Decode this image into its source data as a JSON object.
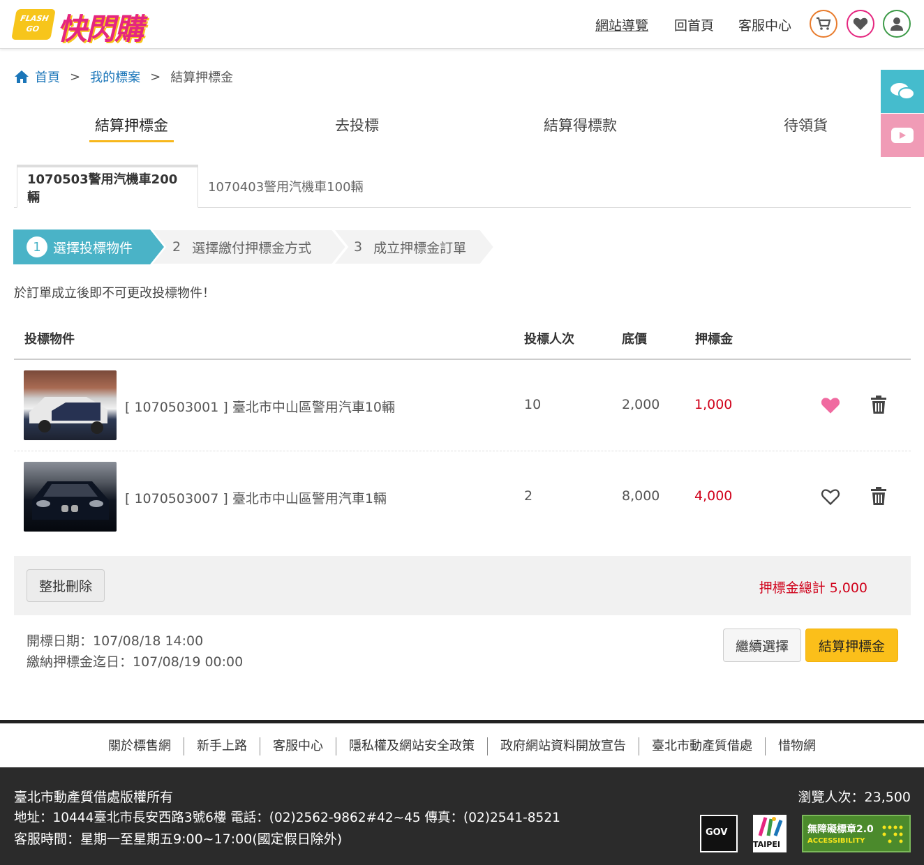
{
  "header": {
    "logo_badge_line1": "FLASH",
    "logo_badge_line2": "GO",
    "logo_text": "快閃購",
    "nav": [
      "網站導覽",
      "回首頁",
      "客服中心"
    ],
    "icons": [
      "cart-icon",
      "heart-icon",
      "user-icon"
    ],
    "colors": {
      "cart": "#e87b2c",
      "heart": "#e5267f",
      "user": "#3c9a47"
    }
  },
  "breadcrumb": {
    "home": "首頁",
    "sep": ">",
    "mine": "我的標案",
    "current": "結算押標金"
  },
  "sidebar": {
    "icons": [
      "chat-icon",
      "youtube-icon"
    ],
    "colors": [
      "#45bccd",
      "#f09bb6"
    ]
  },
  "tabs": [
    "結算押標金",
    "去投標",
    "結算得標款",
    "待領貨"
  ],
  "subtabs": [
    "1070503警用汽機車200輛",
    "1070403警用汽機車100輛"
  ],
  "steps": [
    {
      "num": "1",
      "label": "選擇投標物件"
    },
    {
      "num": "2",
      "label": "選擇繳付押標金方式"
    },
    {
      "num": "3",
      "label": "成立押標金訂單"
    }
  ],
  "note": "於訂單成立後即不可更改投標物件！",
  "table": {
    "headers": [
      "投標物件",
      "投標人次",
      "底價",
      "押標金"
    ],
    "rows": [
      {
        "title": "[ 1070503001 ] 臺北市中山區警用汽車10輛",
        "bidders": "10",
        "base": "2,000",
        "deposit": "1,000",
        "favorited": true
      },
      {
        "title": "[ 1070503007 ] 臺北市中山區警用汽車1輛",
        "bidders": "2",
        "base": "8,000",
        "deposit": "4,000",
        "favorited": false
      }
    ]
  },
  "batch_delete": "整批刪除",
  "total": "押標金總計 5,000",
  "dates": {
    "open": "開標日期：107/08/18 14:00",
    "deadline": "繳納押標金迄日：107/08/19 00:00"
  },
  "buttons": {
    "continue": "繼續選擇",
    "checkout": "結算押標金"
  },
  "footer_links": [
    "關於標售網",
    "新手上路",
    "客服中心",
    "隱私權及網站安全政策",
    "政府網站資料開放宣告",
    "臺北市動產質借處",
    "惜物網"
  ],
  "footer": {
    "copyright": "臺北市動產質借處版權所有",
    "address": "地址：10444臺北市長安西路3號6樓 電話：(02)2562-9862#42~45 傳真：(02)2541-8521",
    "hours": "客服時間：星期一至星期五9:00~17:00(國定假日除外)",
    "visits": "瀏覽人次：23,500",
    "badges": [
      "GOV",
      "TAIPEI",
      "無障礙標章2.0",
      "ACCESSIBILITY"
    ]
  },
  "accent": "#f7b71b",
  "price_color": "#d0021b",
  "step_active_color": "#4ab3c7"
}
